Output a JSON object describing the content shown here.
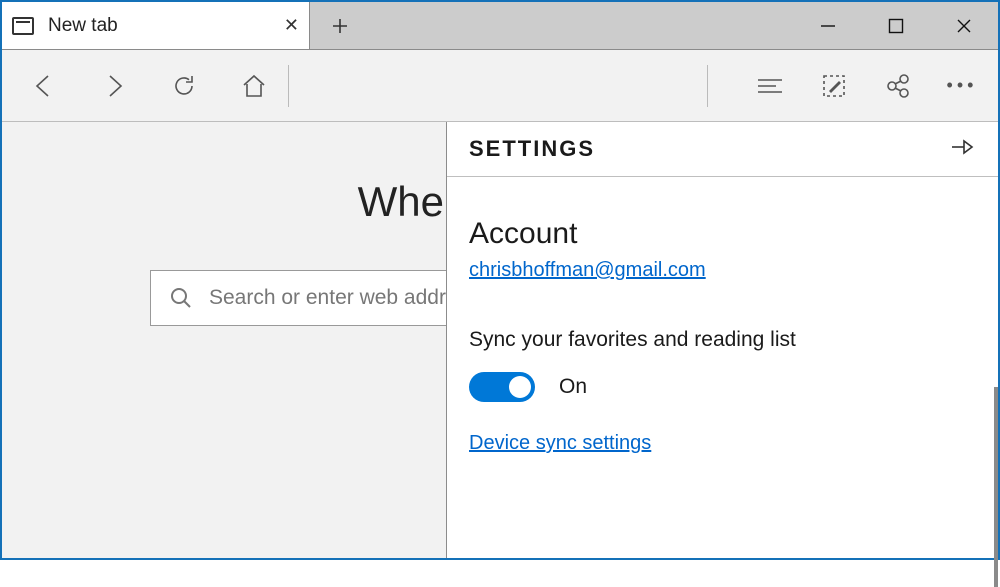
{
  "tab": {
    "title": "New tab",
    "close_aria": "Close tab"
  },
  "newtab_aria": "New tab",
  "window": {
    "minimize_aria": "Minimize",
    "maximize_aria": "Maximize",
    "close_aria": "Close"
  },
  "toolbar": {
    "back_aria": "Back",
    "forward_aria": "Forward",
    "refresh_aria": "Refresh",
    "home_aria": "Home",
    "hub_aria": "Hub",
    "notes_aria": "Web Notes",
    "share_aria": "Share",
    "more_aria": "More"
  },
  "page": {
    "hero_title": "Where to next?",
    "search_placeholder": "Search or enter web address"
  },
  "settings": {
    "header": "SETTINGS",
    "pin_aria": "Pin panel",
    "section_account": "Account",
    "account_email": "chrisbhoffman@gmail.com",
    "sync_label": "Sync your favorites and reading list",
    "toggle_state": "On",
    "device_sync_link": "Device sync settings"
  }
}
